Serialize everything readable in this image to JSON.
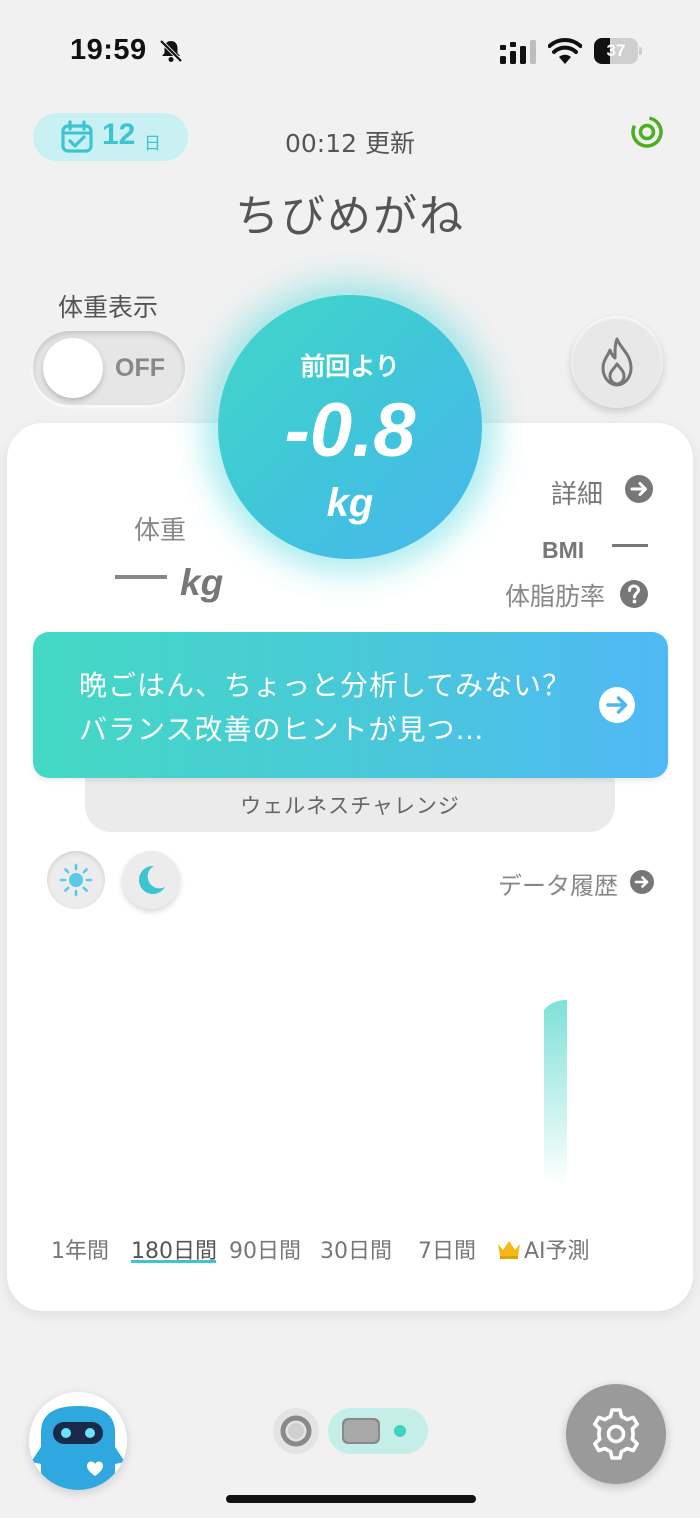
{
  "status_bar": {
    "time": "19:59",
    "battery": "37",
    "battery_level": 0.37
  },
  "header": {
    "day_count": "12",
    "day_unit": "日",
    "update_time": "00:12 更新",
    "user_name": "ちびめがね"
  },
  "weight_toggle": {
    "label": "体重表示",
    "state": "OFF"
  },
  "delta": {
    "label": "前回より",
    "value": "-0.8",
    "unit": "kg"
  },
  "stats": {
    "weight_label": "体重",
    "weight_unit": "kg",
    "detail_link": "詳細",
    "bmi_label": "BMI",
    "fat_label": "体脂肪率"
  },
  "banner": {
    "text": "晩ごはん、ちょっと分析してみない？バランス改善のヒントが見つ…",
    "tab_label": "ウェルネスチャレンジ"
  },
  "chart_controls": {
    "history_link": "データ履歴"
  },
  "period_tabs": [
    {
      "label": "1年間"
    },
    {
      "label": "180日間",
      "active": true
    },
    {
      "label": "90日間"
    },
    {
      "label": "30日間"
    },
    {
      "label": "7日間"
    },
    {
      "label": "AI予測",
      "icon": "crown-icon"
    }
  ],
  "colors": {
    "accent_teal": "#3cc4d3",
    "gradient_start": "#44d9c4",
    "gradient_end": "#4fb9f5",
    "background": "#f1f1f1"
  }
}
